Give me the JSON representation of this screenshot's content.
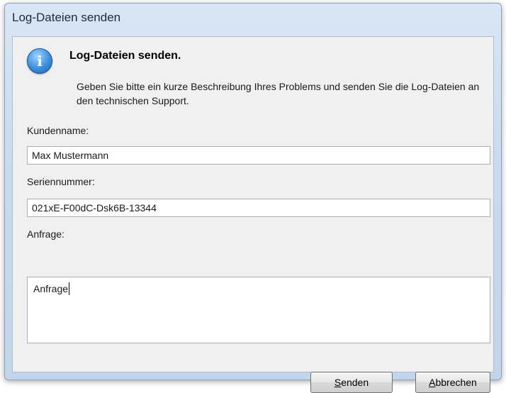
{
  "window": {
    "title": "Log-Dateien senden"
  },
  "message": {
    "icon": "info-icon",
    "heading": "Log-Dateien senden.",
    "description": "Geben Sie bitte ein kurze Beschreibung Ihres Problems und senden Sie die Log-Dateien an den technischen Support."
  },
  "form": {
    "customer_name": {
      "label": "Kundenname:",
      "value": "Max Mustermann"
    },
    "serial_number": {
      "label": "Seriennummer:",
      "value": "021xE-F00dC-Dsk6B-13344"
    },
    "request": {
      "label": "Anfrage:",
      "value": "Anfrage"
    }
  },
  "buttons": {
    "send": {
      "accel": "S",
      "rest": "enden"
    },
    "cancel": {
      "accel": "A",
      "rest": "bbrechen"
    }
  }
}
